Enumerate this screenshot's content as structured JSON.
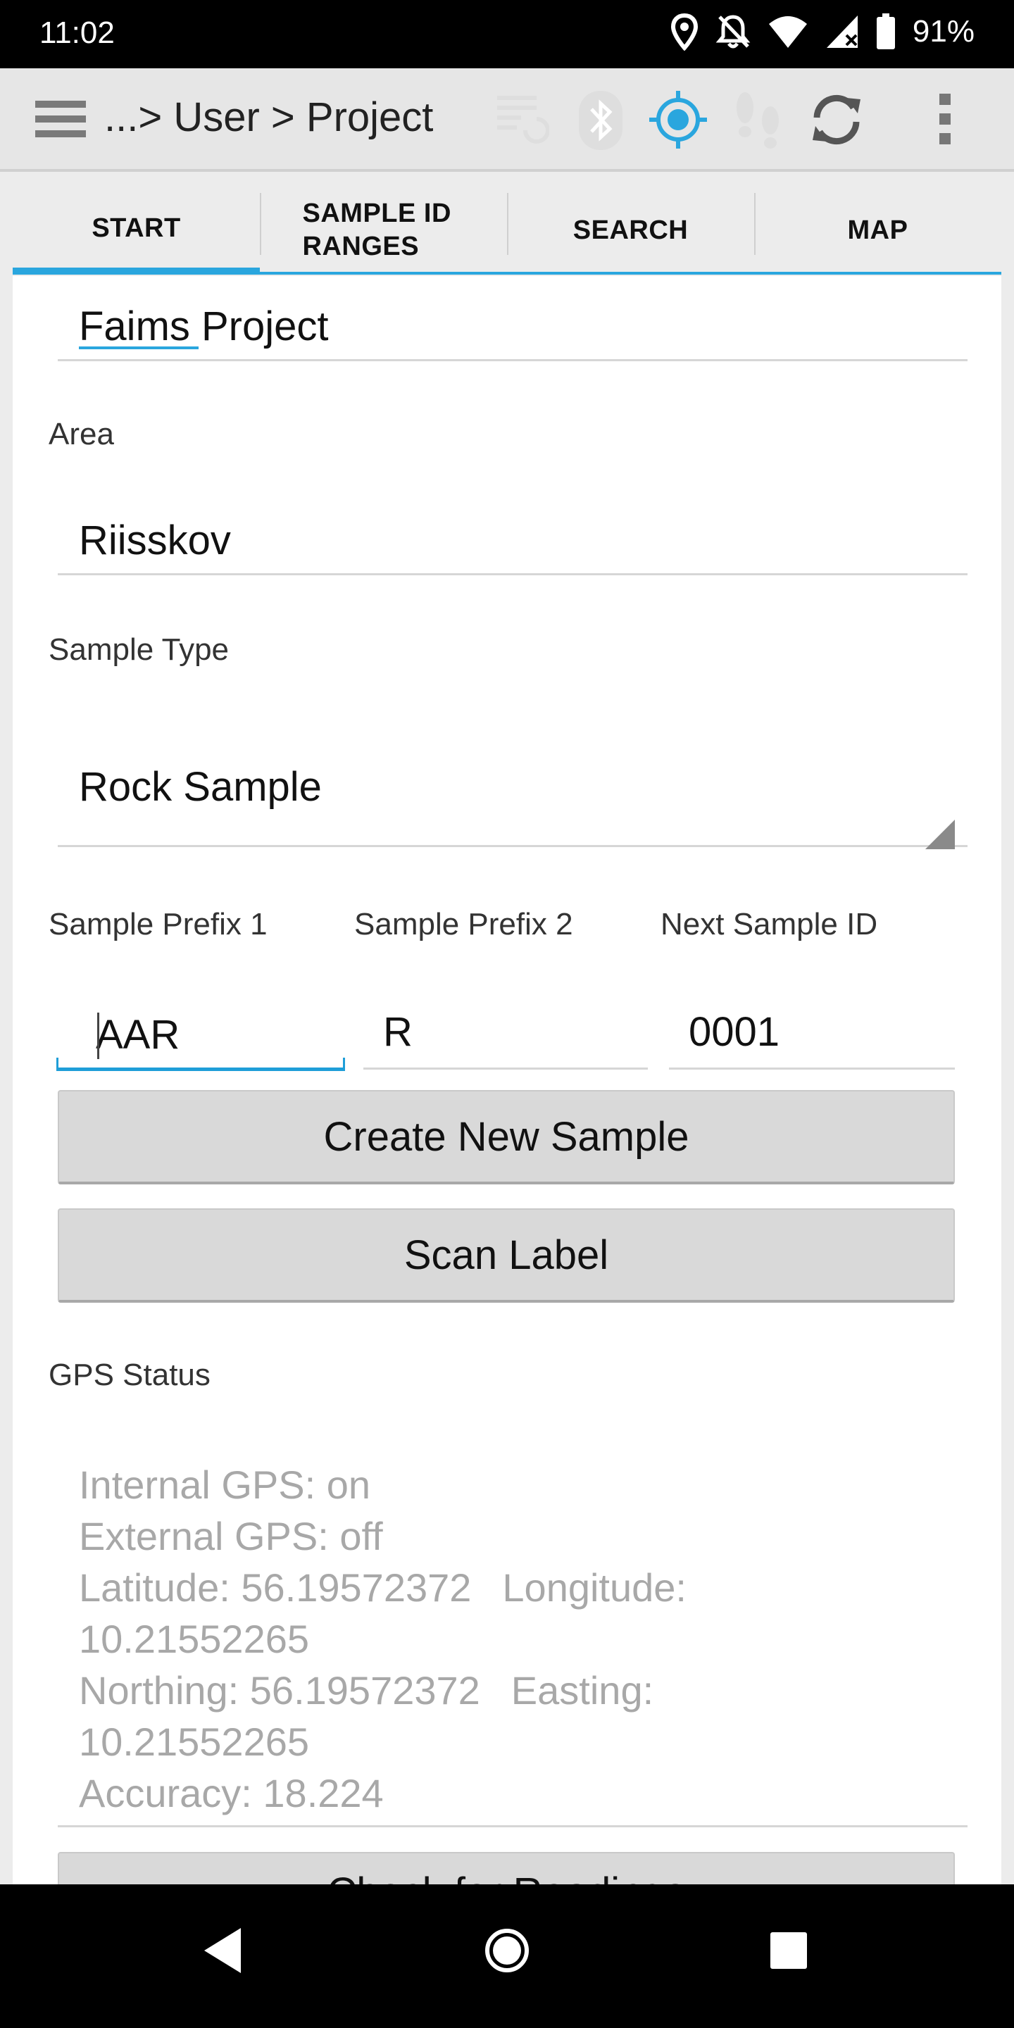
{
  "status_bar": {
    "time": "11:02",
    "battery": "91%",
    "icons": [
      "location-icon",
      "notifications-off-icon",
      "wifi-icon",
      "cell-signal-icon",
      "battery-icon"
    ]
  },
  "action_bar": {
    "breadcrumb": "...> User > Project",
    "icons": [
      "menu-icon",
      "sync-list-icon",
      "bluetooth-icon",
      "gps-target-icon",
      "footsteps-icon",
      "refresh-icon",
      "overflow-menu-icon"
    ],
    "accent_color": "#2aa6de"
  },
  "tabs": [
    {
      "label": "START",
      "active": true
    },
    {
      "label": "SAMPLE ID RANGES",
      "active": false
    },
    {
      "label": "SEARCH",
      "active": false
    },
    {
      "label": "MAP",
      "active": false
    }
  ],
  "form": {
    "project_value": "Faims Project",
    "area_label": "Area",
    "area_value": "Riisskov",
    "sample_type_label": "Sample Type",
    "sample_type_value": "Rock Sample",
    "prefix1_label": "Sample Prefix 1",
    "prefix1_value": "AAR",
    "prefix2_label": "Sample Prefix 2",
    "prefix2_value": "R",
    "next_id_label": "Next Sample ID",
    "next_id_value": "0001",
    "create_button": "Create New Sample",
    "scan_button": "Scan Label",
    "gps_label": "GPS Status",
    "gps": {
      "internal": "Internal GPS: on",
      "external": "External GPS: off",
      "latitude": "Latitude: 56.19572372",
      "longitude": "Longitude:",
      "longitude_value": "10.21552265",
      "northing": "Northing: 56.19572372",
      "easting": "Easting:",
      "easting_value": "10.21552265",
      "accuracy": "Accuracy: 18.224"
    },
    "partial_button": "Check for Readings"
  },
  "nav_bar": {
    "icons": [
      "back-icon",
      "home-icon",
      "recents-icon"
    ]
  }
}
